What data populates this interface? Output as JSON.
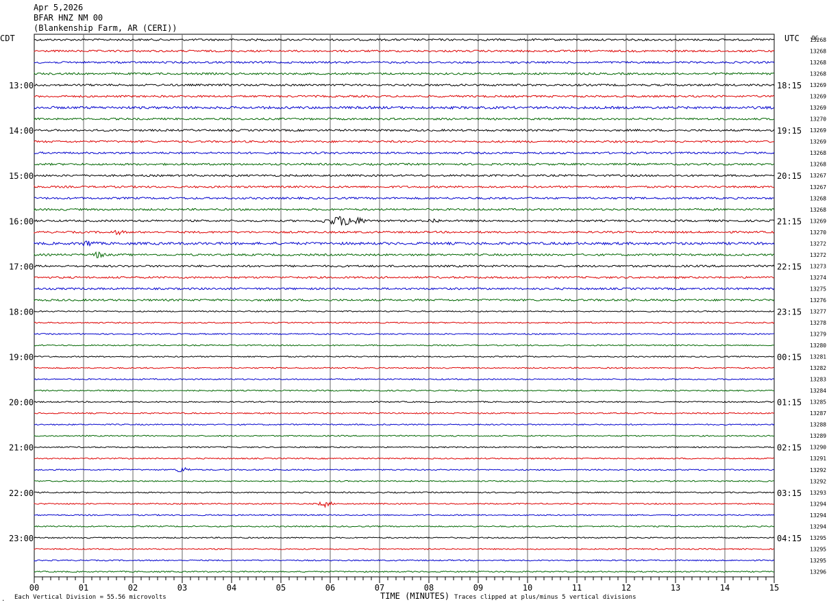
{
  "header": {
    "date": "Apr 5,2026",
    "station": "BFAR HNZ NM 00",
    "site": "(Blankenship Farm, AR (CERI))"
  },
  "chart_data": {
    "type": "line",
    "title": "Apr 5,2026",
    "left_axis_label": "CDT",
    "right_axis_label": "UTC",
    "dc_label": "DC",
    "xlabel": "TIME (MINUTES)",
    "x_ticks": [
      "00",
      "01",
      "02",
      "03",
      "04",
      "05",
      "06",
      "07",
      "08",
      "09",
      "10",
      "11",
      "12",
      "13",
      "14",
      "15"
    ],
    "xlim": [
      0,
      15
    ],
    "left_hour_labels": [
      "13:00",
      "14:00",
      "15:00",
      "16:00",
      "17:00",
      "18:00",
      "19:00",
      "20:00",
      "21:00",
      "22:00",
      "23:00"
    ],
    "right_hour_labels": [
      "18:15",
      "19:15",
      "20:15",
      "21:15",
      "22:15",
      "23:15",
      "00:15",
      "01:15",
      "02:15",
      "03:15",
      "04:15"
    ],
    "trace_colors": [
      "#000000",
      "#dd0000",
      "#0000cc",
      "#006600"
    ],
    "trace_count": 48,
    "dc_offsets": [
      "13268",
      "13268",
      "13268",
      "13268",
      "13269",
      "13269",
      "13269",
      "13270",
      "13269",
      "13269",
      "13268",
      "13268",
      "13267",
      "13267",
      "13268",
      "13268",
      "13269",
      "13270",
      "13272",
      "13272",
      "13273",
      "13274",
      "13275",
      "13276",
      "13277",
      "13278",
      "13279",
      "13280",
      "13281",
      "13282",
      "13283",
      "13284",
      "13285",
      "13287",
      "13288",
      "13289",
      "13290",
      "13291",
      "13292",
      "13292",
      "13293",
      "13294",
      "13294",
      "13294",
      "13295",
      "13295",
      "13295",
      "13296"
    ],
    "events": [
      {
        "trace": 16,
        "minute": 6.3,
        "amplitude": "large"
      },
      {
        "trace": 16,
        "minute": 8.1,
        "amplitude": "small"
      },
      {
        "trace": 17,
        "minute": 1.7,
        "amplitude": "small"
      },
      {
        "trace": 18,
        "minute": 1.1,
        "amplitude": "medium"
      },
      {
        "trace": 19,
        "minute": 1.3,
        "amplitude": "medium"
      },
      {
        "trace": 38,
        "minute": 3.0,
        "amplitude": "medium"
      },
      {
        "trace": 41,
        "minute": 5.9,
        "amplitude": "medium"
      }
    ]
  },
  "footer": {
    "scale_prefix": "Each Vertical Division =",
    "scale_value": "55.56 microvolts",
    "clip_note": "Traces clipped at plus/minus 5 vertical divisions"
  }
}
